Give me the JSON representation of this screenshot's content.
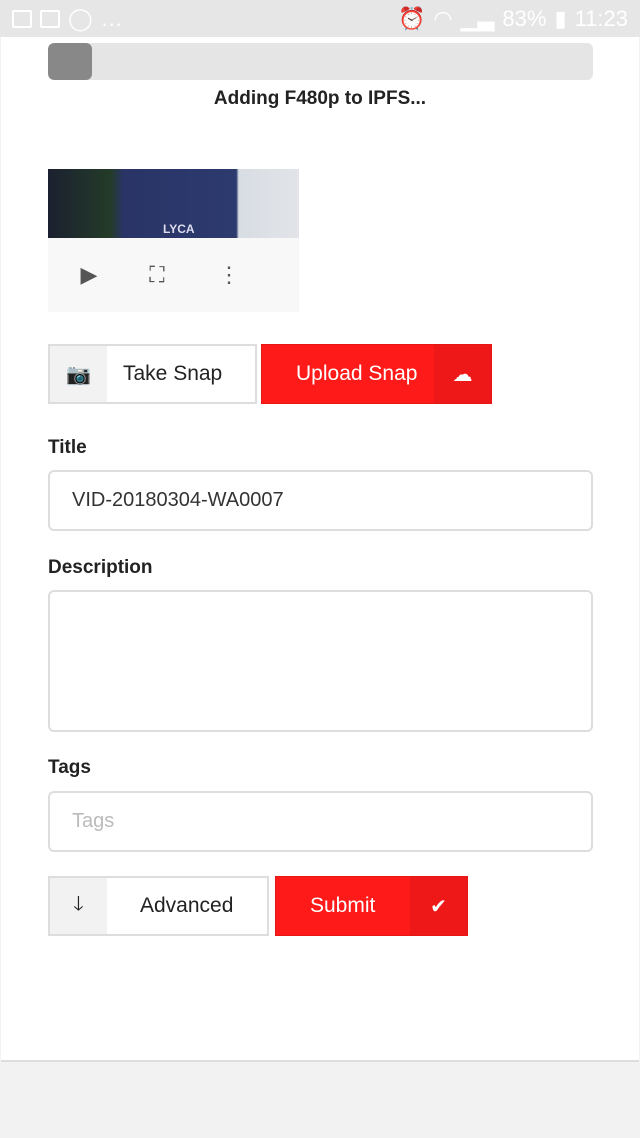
{
  "status": {
    "battery": "83%",
    "time": "11:23"
  },
  "upload": {
    "progress_percent": 8,
    "message": "Adding F480p to IPFS..."
  },
  "video": {
    "overlay_text": "LYCA"
  },
  "buttons": {
    "take_snap": "Take Snap",
    "upload_snap": "Upload Snap",
    "advanced": "Advanced",
    "submit": "Submit"
  },
  "form": {
    "title_label": "Title",
    "title_value": "VID-20180304-WA0007",
    "description_label": "Description",
    "description_value": "",
    "tags_label": "Tags",
    "tags_placeholder": "Tags"
  },
  "colors": {
    "accent": "#ff1a1a"
  }
}
